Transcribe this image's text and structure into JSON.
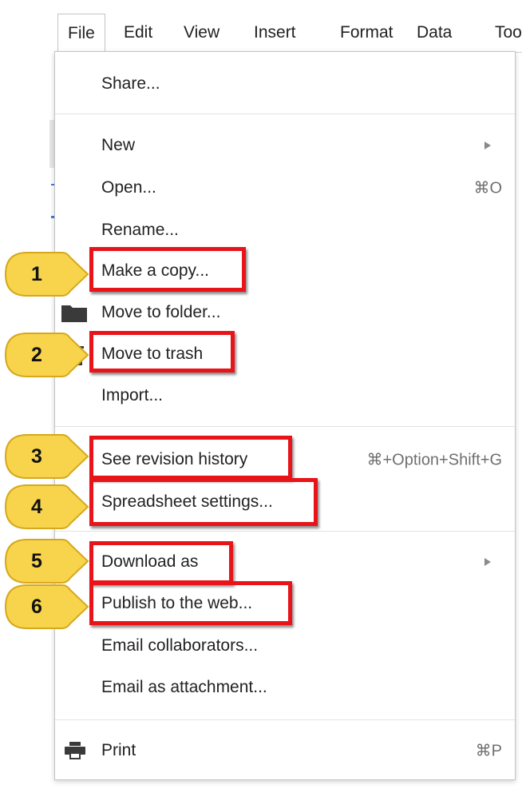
{
  "menubar": {
    "items": [
      {
        "label": "File",
        "active": true
      },
      {
        "label": "Edit"
      },
      {
        "label": "View"
      },
      {
        "label": "Insert"
      },
      {
        "label": "Format"
      },
      {
        "label": "Data"
      },
      {
        "label": "Too"
      }
    ]
  },
  "file_menu": {
    "share": "Share...",
    "new": "New",
    "open": "Open...",
    "open_shortcut": "⌘O",
    "rename": "Rename...",
    "make_copy": "Make a copy...",
    "move_to_folder": "Move to folder...",
    "move_to_trash": "Move to trash",
    "import": "Import...",
    "revision_history": "See revision history",
    "revision_history_shortcut": "⌘+Option+Shift+G",
    "spreadsheet_settings": "Spreadsheet settings...",
    "download_as": "Download as",
    "publish": "Publish to the web...",
    "email_collaborators": "Email collaborators...",
    "email_attachment": "Email as attachment...",
    "print": "Print",
    "print_shortcut": "⌘P"
  },
  "callouts": [
    "1",
    "2",
    "3",
    "4",
    "5",
    "6"
  ],
  "colors": {
    "highlight": "#e8141a",
    "callout_fill": "#f7d44c",
    "callout_stroke": "#d6a81b"
  }
}
